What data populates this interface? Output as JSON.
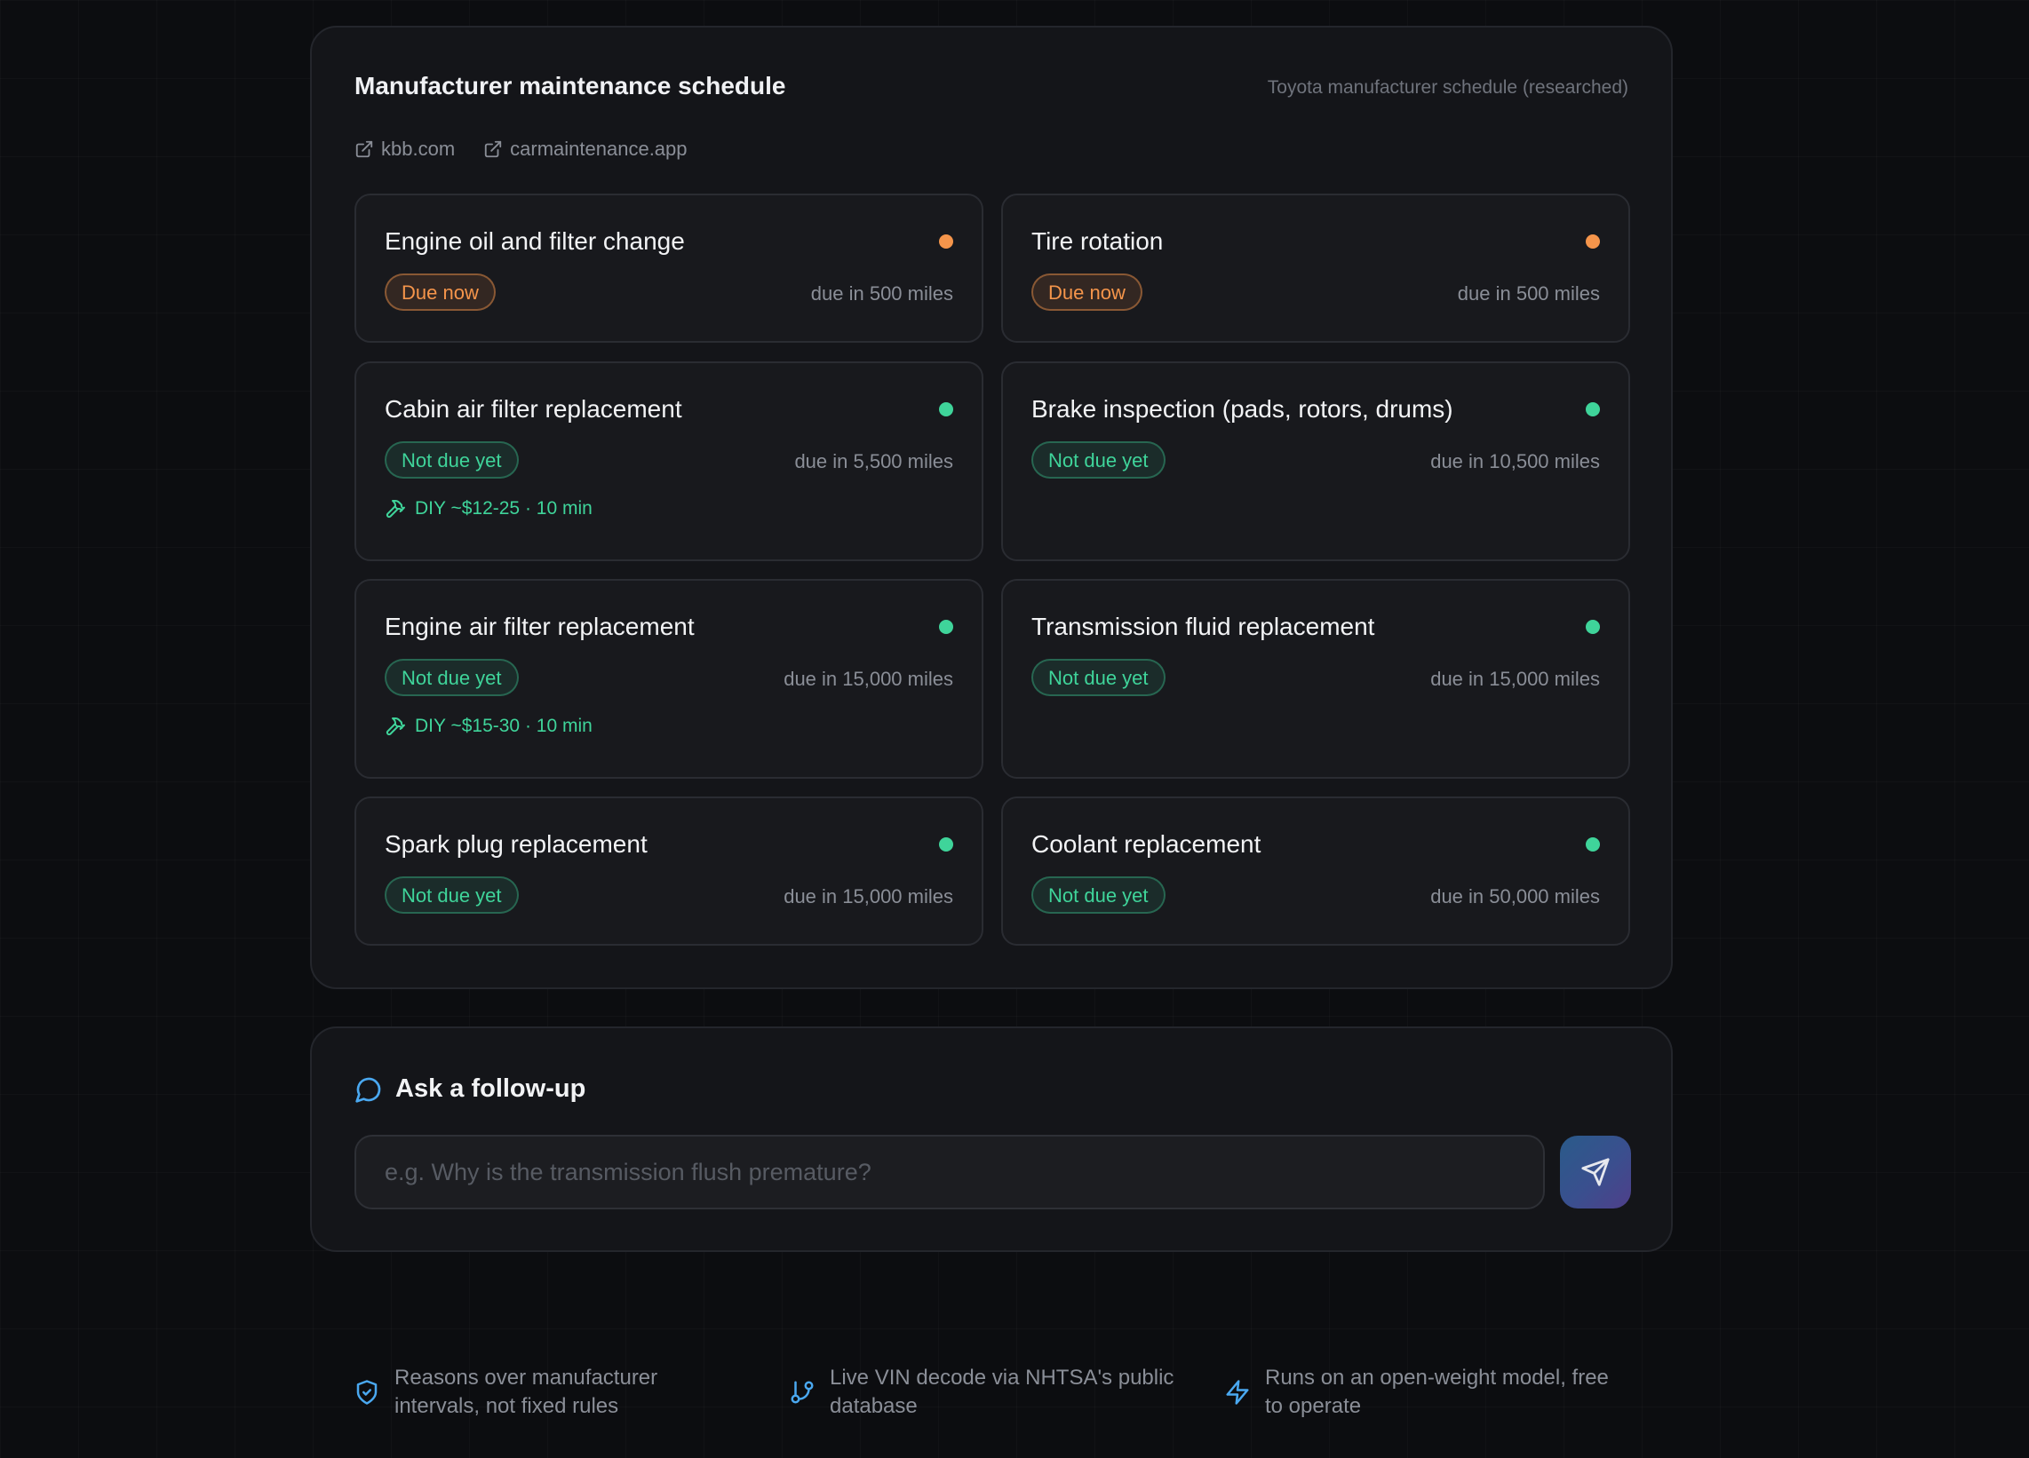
{
  "schedule": {
    "title": "Manufacturer maintenance schedule",
    "subtitle": "Toyota manufacturer schedule (researched)",
    "sources": [
      "kbb.com",
      "carmaintenance.app"
    ],
    "colors": {
      "due": "#f5954b",
      "ok": "#3fd49a"
    },
    "items": [
      {
        "title": "Engine oil and filter change",
        "status": "Due now",
        "due": "due in 500 miles",
        "diy": ""
      },
      {
        "title": "Tire rotation",
        "status": "Due now",
        "due": "due in 500 miles",
        "diy": ""
      },
      {
        "title": "Cabin air filter replacement",
        "status": "Not due yet",
        "due": "due in 5,500 miles",
        "diy": "DIY ~$12-25 · 10 min"
      },
      {
        "title": "Brake inspection (pads, rotors, drums)",
        "status": "Not due yet",
        "due": "due in 10,500 miles",
        "diy": ""
      },
      {
        "title": "Engine air filter replacement",
        "status": "Not due yet",
        "due": "due in 15,000 miles",
        "diy": "DIY ~$15-30 · 10 min"
      },
      {
        "title": "Transmission fluid replacement",
        "status": "Not due yet",
        "due": "due in 15,000 miles",
        "diy": ""
      },
      {
        "title": "Spark plug replacement",
        "status": "Not due yet",
        "due": "due in 15,000 miles",
        "diy": ""
      },
      {
        "title": "Coolant replacement",
        "status": "Not due yet",
        "due": "due in 50,000 miles",
        "diy": ""
      }
    ]
  },
  "followup": {
    "title": "Ask a follow-up",
    "placeholder": "e.g. Why is the transmission flush premature?",
    "send_icon": "send-icon"
  },
  "features": [
    {
      "icon": "shield-check-icon",
      "line1": "Reasons over manufacturer",
      "line2": "intervals, not fixed rules"
    },
    {
      "icon": "git-branch-icon",
      "line1": "Live VIN decode via NHTSA's public",
      "line2": "database"
    },
    {
      "icon": "lightning-icon",
      "line1": "Runs on an open-weight model, free",
      "line2": "to operate"
    }
  ]
}
